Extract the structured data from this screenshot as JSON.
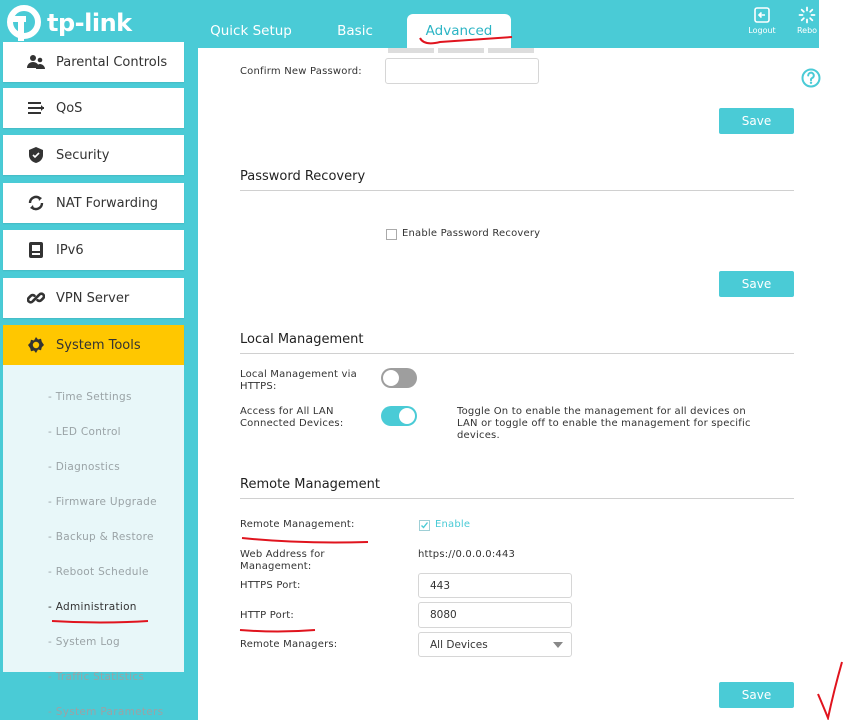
{
  "header": {
    "logo_text": "tp-link",
    "tabs": [
      {
        "label": "Quick Setup"
      },
      {
        "label": "Basic"
      },
      {
        "label": "Advanced"
      }
    ],
    "logout_label": "Logout",
    "reboot_label": "Rebo"
  },
  "sidebar": {
    "items": [
      {
        "label": "Parental Controls",
        "icon": "parental-controls-icon"
      },
      {
        "label": "QoS",
        "icon": "qos-icon"
      },
      {
        "label": "Security",
        "icon": "shield-icon"
      },
      {
        "label": "NAT Forwarding",
        "icon": "nat-forwarding-icon"
      },
      {
        "label": "IPv6",
        "icon": "ipv6-icon"
      },
      {
        "label": "VPN Server",
        "icon": "vpn-icon"
      },
      {
        "label": "System Tools",
        "icon": "gear-icon"
      }
    ],
    "sub_items": [
      {
        "label": "Time Settings"
      },
      {
        "label": "LED Control"
      },
      {
        "label": "Diagnostics"
      },
      {
        "label": "Firmware Upgrade"
      },
      {
        "label": "Backup & Restore"
      },
      {
        "label": "Reboot Schedule"
      },
      {
        "label": "Administration"
      },
      {
        "label": "System Log"
      },
      {
        "label": "Traffic Statistics"
      },
      {
        "label": "System Parameters"
      }
    ]
  },
  "password": {
    "confirm_label": "Confirm New Password:",
    "confirm_value": "",
    "save_label": "Save"
  },
  "recovery": {
    "title": "Password Recovery",
    "checkbox_label": "Enable Password Recovery",
    "save_label": "Save"
  },
  "local": {
    "title": "Local Management",
    "https_label": "Local Management via HTTPS:",
    "all_lan_label": "Access for All LAN Connected Devices:",
    "hint": "Toggle On to enable the management for all devices on LAN or toggle off to enable the management for specific devices."
  },
  "remote": {
    "title": "Remote Management",
    "remote_label": "Remote Management:",
    "enable_label": "Enable",
    "web_address_label": "Web Address for Management:",
    "web_address_value": "https://0.0.0.0:443",
    "https_port_label": "HTTPS Port:",
    "https_port_value": "443",
    "http_port_label": "HTTP Port:",
    "http_port_value": "8080",
    "managers_label": "Remote Managers:",
    "managers_value": "All Devices",
    "save_label": "Save"
  },
  "colors": {
    "brand": "#4acbd6",
    "active_menu": "#ffc700",
    "toggle_off": "#9e9e9e",
    "annotation": "#e0141e"
  }
}
